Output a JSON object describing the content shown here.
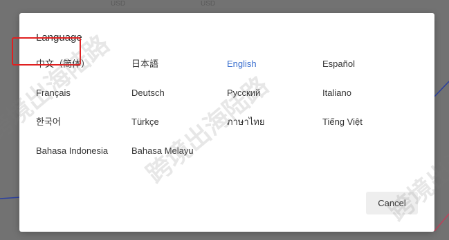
{
  "background": {
    "axis_labels": [
      "USD",
      "USD"
    ]
  },
  "dialog": {
    "title": "Language",
    "languages": [
      {
        "label": "中文（简体）",
        "active": false
      },
      {
        "label": "日本語",
        "active": false
      },
      {
        "label": "English",
        "active": true
      },
      {
        "label": "Español",
        "active": false
      },
      {
        "label": "Français",
        "active": false
      },
      {
        "label": "Deutsch",
        "active": false
      },
      {
        "label": "Русский",
        "active": false
      },
      {
        "label": "Italiano",
        "active": false
      },
      {
        "label": "한국어",
        "active": false
      },
      {
        "label": "Türkçe",
        "active": false
      },
      {
        "label": "ภาษาไทย",
        "active": false
      },
      {
        "label": "Tiếng Việt",
        "active": false
      },
      {
        "label": "Bahasa Indonesia",
        "active": false
      },
      {
        "label": "Bahasa Melayu",
        "active": false
      }
    ],
    "cancel_label": "Cancel"
  },
  "watermark": {
    "text": "跨境出海陆路"
  },
  "colors": {
    "active_language": "#3a6fcf",
    "highlight": "#e02020"
  }
}
